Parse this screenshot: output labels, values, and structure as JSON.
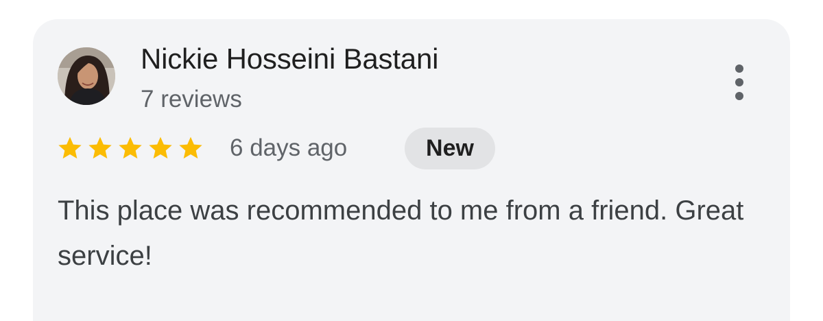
{
  "review": {
    "author_name": "Nickie Hosseini Bastani",
    "author_meta": "7 reviews",
    "rating": 5,
    "rating_max": 5,
    "time_ago": "6 days ago",
    "badge": "New",
    "text": "This place was recommended to me from a friend. Great service!"
  },
  "icons": {
    "star": "star-icon",
    "more": "more-vertical-icon"
  },
  "colors": {
    "card_background": "#f3f4f6",
    "star": "#fbbc04",
    "badge_background": "#e2e3e5",
    "primary_text": "#1f1f1f",
    "secondary_text": "#5f6368"
  }
}
